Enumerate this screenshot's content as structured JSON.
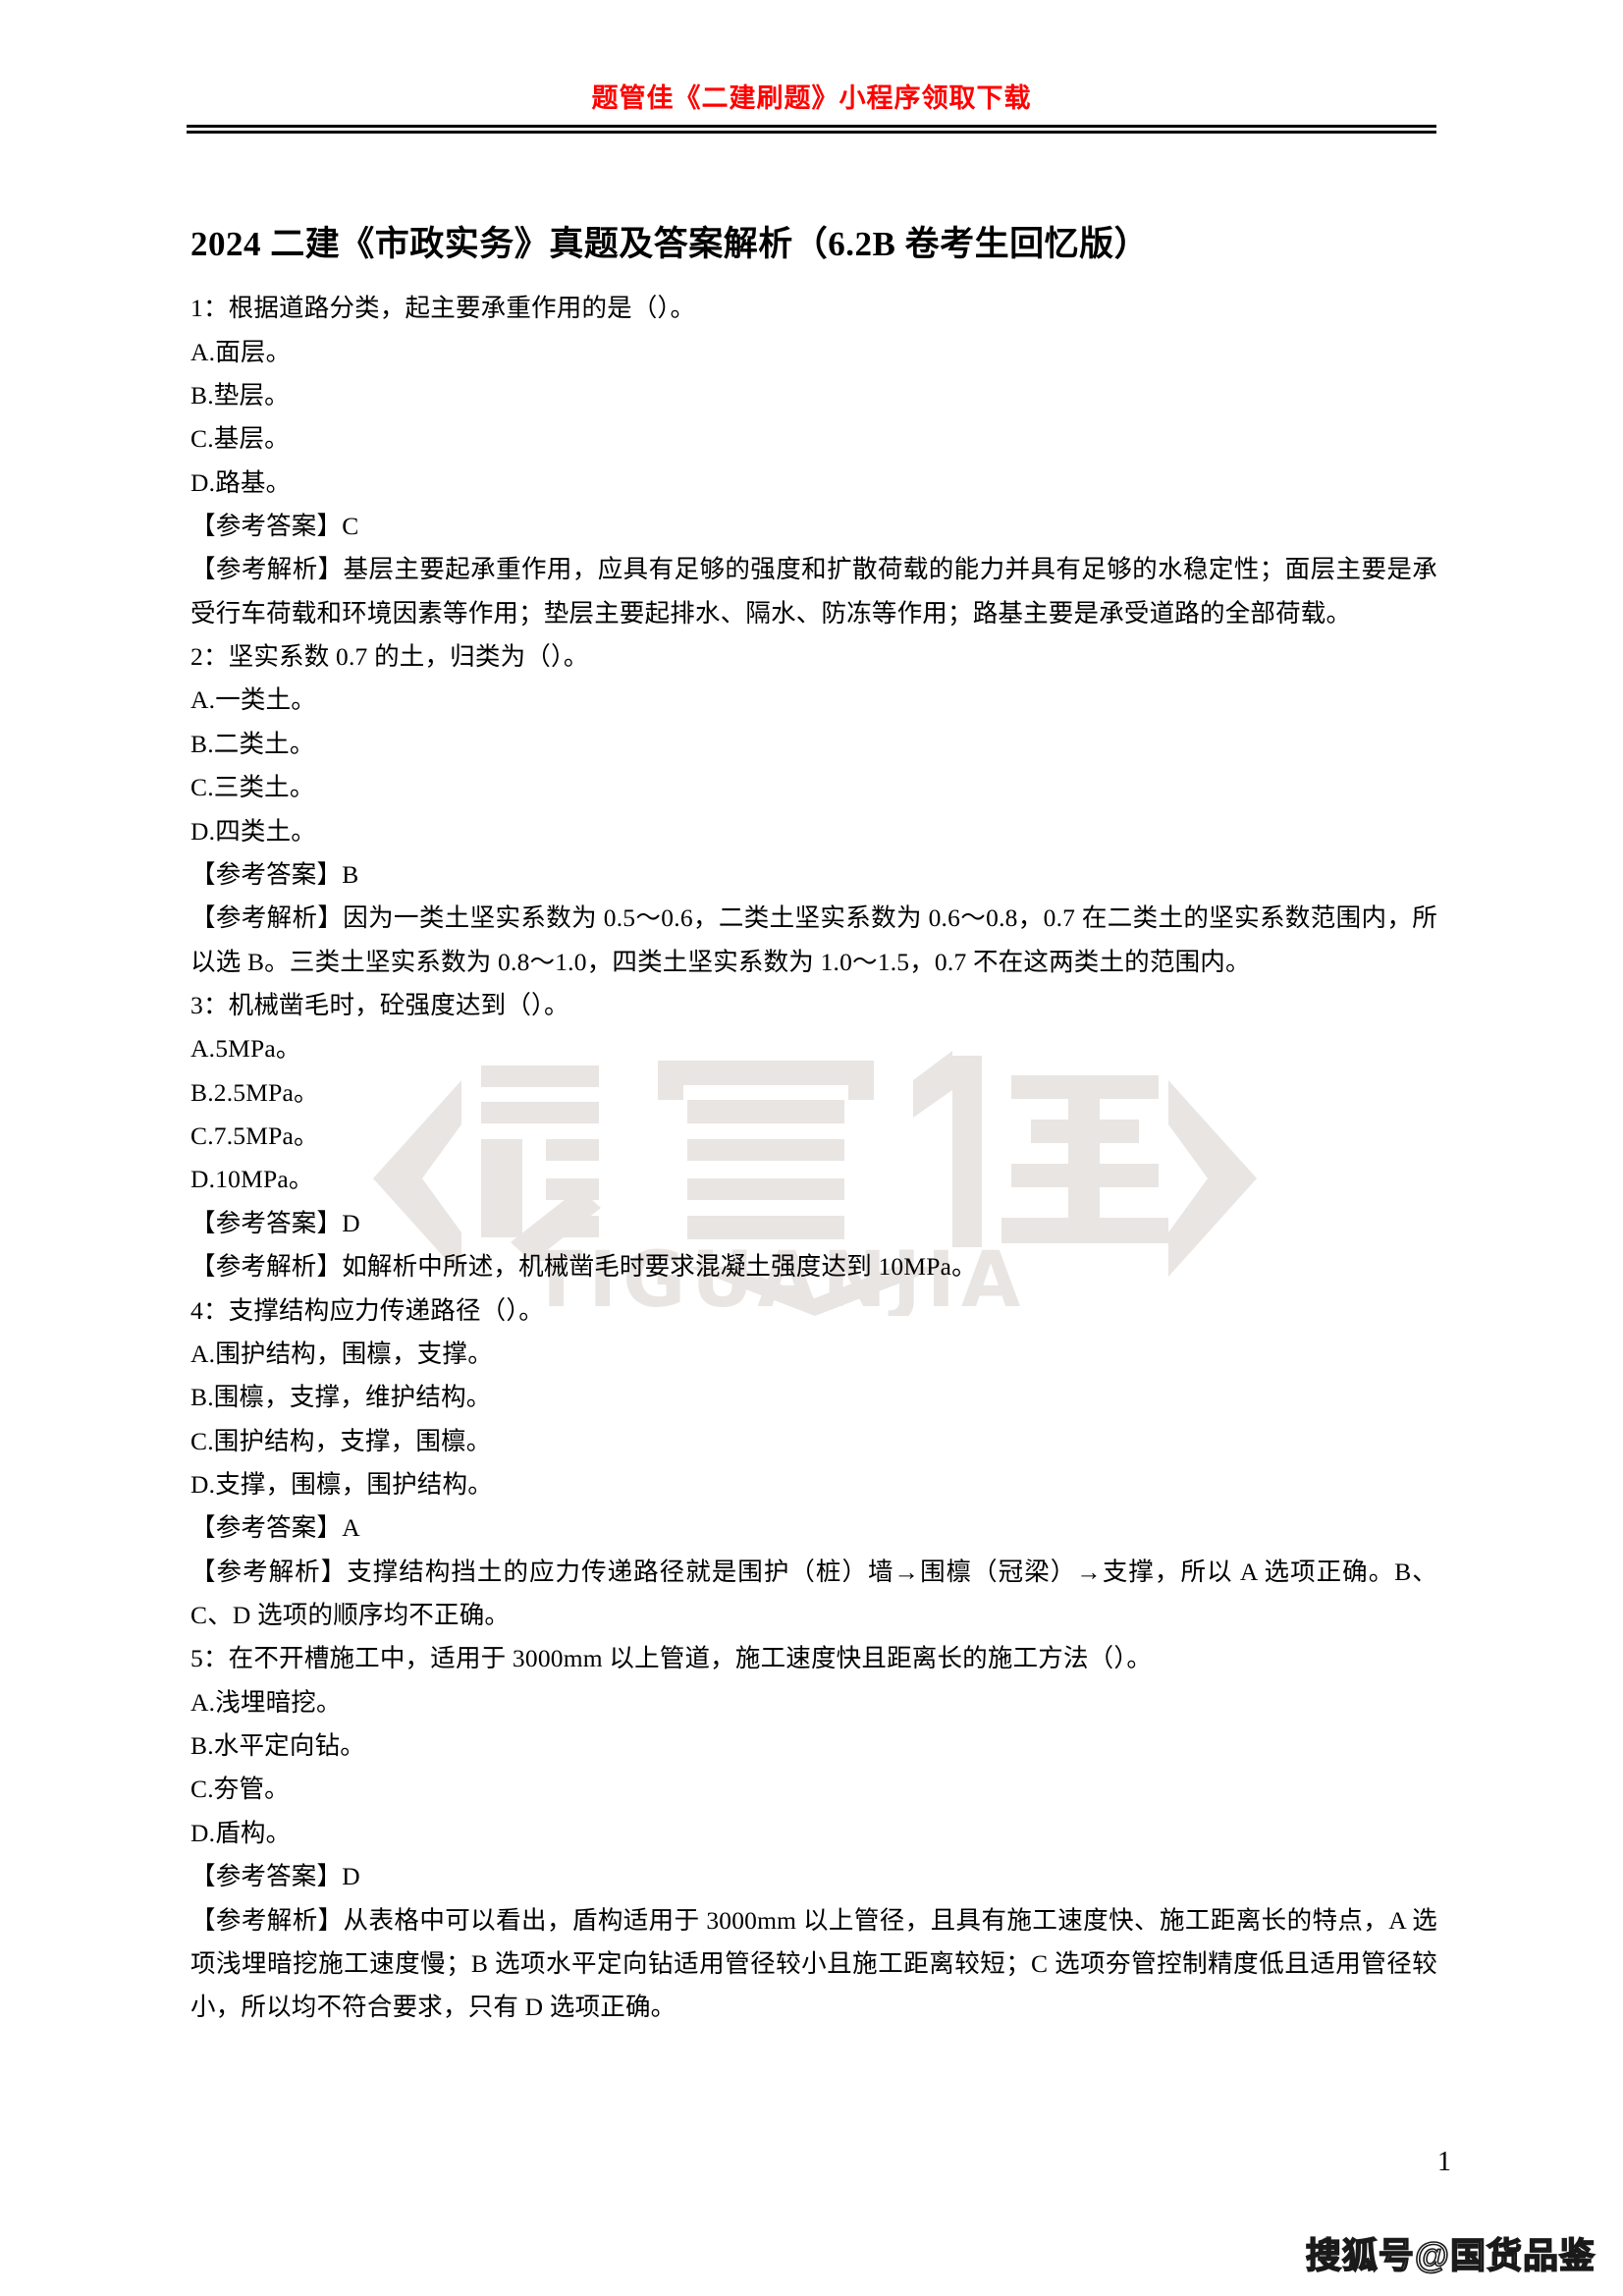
{
  "header": {
    "banner": "题管佳《二建刷题》小程序领取下载"
  },
  "document": {
    "title": "2024 二建《市政实务》真题及答案解析（6.2B 卷考生回忆版）",
    "page_number": "1"
  },
  "watermark": {
    "logo_text": "题管佳",
    "logo_subtext": "TIGUANJIA",
    "footer_text": "搜狐号@国货品鉴",
    "color": "#e8e4e2"
  },
  "questions": [
    {
      "stem": "1：根据道路分类，起主要承重作用的是（）。",
      "options": [
        "A.面层。",
        "B.垫层。",
        "C.基层。",
        "D.路基。"
      ],
      "answer": "【参考答案】C",
      "explanation": "【参考解析】基层主要起承重作用，应具有足够的强度和扩散荷载的能力并具有足够的水稳定性；面层主要是承受行车荷载和环境因素等作用；垫层主要起排水、隔水、防冻等作用；路基主要是承受道路的全部荷载。"
    },
    {
      "stem": "2：坚实系数 0.7 的土，归类为（）。",
      "options": [
        "A.一类土。",
        "B.二类土。",
        "C.三类土。",
        "D.四类土。"
      ],
      "answer": "【参考答案】B",
      "explanation": "【参考解析】因为一类土坚实系数为 0.5～0.6，二类土坚实系数为 0.6～0.8，0.7 在二类土的坚实系数范围内，所以选 B。三类土坚实系数为 0.8～1.0，四类土坚实系数为 1.0～1.5，0.7 不在这两类土的范围内。"
    },
    {
      "stem": "3：机械凿毛时，砼强度达到（）。",
      "options": [
        "A.5MPa。",
        "B.2.5MPa。",
        "C.7.5MPa。",
        "D.10MPa。"
      ],
      "answer": "【参考答案】D",
      "explanation": "【参考解析】如解析中所述，机械凿毛时要求混凝土强度达到 10MPa。"
    },
    {
      "stem": "4：支撑结构应力传递路径（）。",
      "options": [
        "A.围护结构，围檩，支撑。",
        "B.围檩，支撑，维护结构。",
        "C.围护结构，支撑，围檩。",
        "D.支撑，围檩，围护结构。"
      ],
      "answer": "【参考答案】A",
      "explanation": "【参考解析】支撑结构挡土的应力传递路径就是围护（桩）墙→围檩（冠梁）→支撑，所以 A 选项正确。B、C、D 选项的顺序均不正确。"
    },
    {
      "stem": "5：在不开槽施工中，适用于 3000mm 以上管道，施工速度快且距离长的施工方法（）。",
      "options": [
        "A.浅埋暗挖。",
        "B.水平定向钻。",
        "C.夯管。",
        "D.盾构。"
      ],
      "answer": "【参考答案】D",
      "explanation": "【参考解析】从表格中可以看出，盾构适用于 3000mm 以上管径，且具有施工速度快、施工距离长的特点，A 选项浅埋暗挖施工速度慢；B 选项水平定向钻适用管径较小且施工距离较短；C 选项夯管控制精度低且适用管径较小，所以均不符合要求，只有 D 选项正确。"
    }
  ]
}
